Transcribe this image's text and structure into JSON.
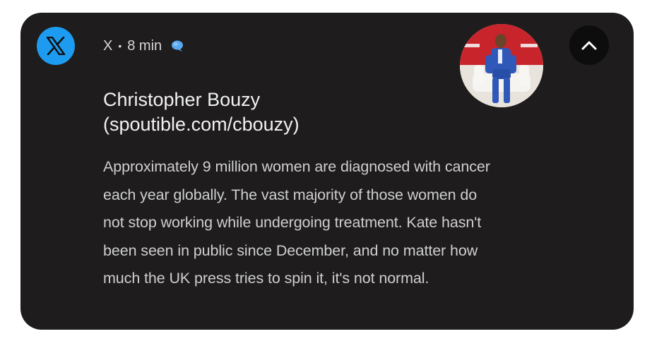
{
  "notification": {
    "app_icon": "x-logo-icon",
    "app_name": "X",
    "separator": "•",
    "time_ago": "8 min",
    "status_icon": "chat-bubble-icon",
    "author_name": "Christopher Bouzy",
    "author_handle": "(spoutible.com/cbouzy)",
    "avatar_icon": "profile-photo-avatar",
    "collapse_icon": "chevron-up-icon",
    "body_lines": [
      "Approximately 9 million women are diagnosed with cancer",
      "each year globally. The vast majority of those women do",
      "not stop working while undergoing treatment. Kate hasn't",
      "been seen in public since December, and no matter how",
      "much the UK press tries to spin it, it's not normal."
    ]
  },
  "colors": {
    "card_background": "#1e1c1c",
    "app_icon_background": "#1d9bf0",
    "accent_blue": "#5aa8ee",
    "author_text": "#f2f2f2",
    "body_text": "#cfcfcf",
    "avatar_red": "#c8242c",
    "avatar_suit_blue": "#2f58b8"
  }
}
